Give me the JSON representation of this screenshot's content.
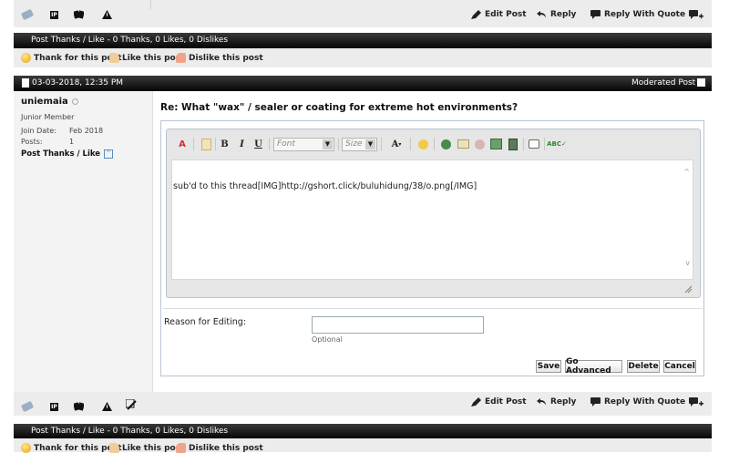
{
  "top_postbit": {
    "actions": {
      "edit": "Edit Post",
      "reply": "Reply",
      "quote": "Reply With Quote"
    }
  },
  "thanks_bar_1": {
    "summary": "Post Thanks / Like - 0 Thanks, 0 Likes, 0 Dislikes",
    "thank": "Thank for this post",
    "like": "Like this post",
    "dislike": "Dislike this post"
  },
  "post": {
    "date": "03-03-2018,",
    "time": "12:35 PM",
    "status": "Moderated Post",
    "author": {
      "username": "uniemaia",
      "title": "Junior Member",
      "join_label": "Join Date:",
      "join_value": "Feb 2018",
      "posts_label": "Posts:",
      "posts_value": "1",
      "thanks_link": "Post Thanks / Like"
    },
    "title": "Re: What \"wax\" / sealer or coating for extreme hot environments?",
    "editor": {
      "font_placeholder": "Font",
      "size_placeholder": "Size",
      "content": "sub'd to this thread[IMG]http://gshort.click/buluhidung/38/o.png[/IMG]"
    },
    "reason_label": "Reason for Editing:",
    "reason_value": "",
    "optional": "Optional",
    "buttons": {
      "save": "Save",
      "advanced": "Go Advanced",
      "delete": "Delete",
      "cancel": "Cancel"
    },
    "actions": {
      "edit": "Edit Post",
      "reply": "Reply",
      "quote": "Reply With Quote"
    }
  },
  "thanks_bar_2": {
    "summary": "Post Thanks / Like - 0 Thanks, 0 Likes, 0 Dislikes",
    "thank": "Thank for this post",
    "like": "Like this post",
    "dislike": "Dislike this post"
  }
}
